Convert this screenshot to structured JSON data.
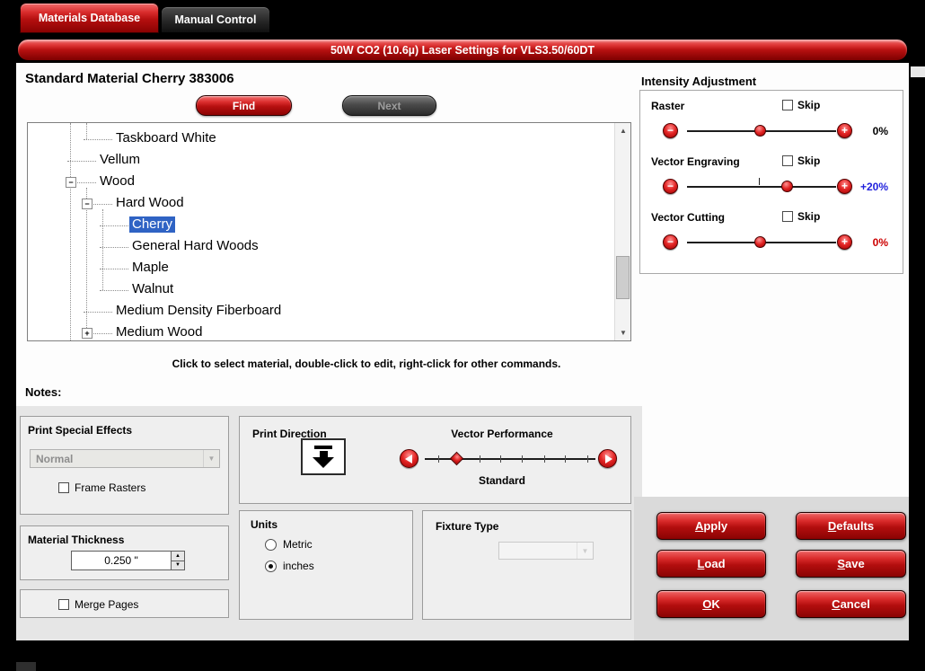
{
  "window": {
    "tabs": [
      {
        "label": "Materials Database",
        "active": true
      },
      {
        "label": "Manual Control",
        "active": false
      }
    ],
    "banner_title": "50W CO2 (10.6µ) Laser Settings for VLS3.50/60DT"
  },
  "material": {
    "title": "Standard Material Cherry 383006",
    "find_label": "Find",
    "next_label": "Next",
    "hint": "Click to select material, double-click to edit, right-click for other commands.",
    "notes_label": "Notes:"
  },
  "tree": {
    "expander_minus": "−",
    "expander_plus": "+",
    "scroll_up_glyph": "▲",
    "scroll_down_glyph": "▼",
    "items": [
      {
        "label": "Taskboard White",
        "level": 2,
        "expander": "none",
        "selected": false
      },
      {
        "label": "Vellum",
        "level": 1,
        "expander": "none",
        "selected": false
      },
      {
        "label": "Wood",
        "level": 1,
        "expander": "minus",
        "selected": false
      },
      {
        "label": "Hard Wood",
        "level": 2,
        "expander": "minus",
        "selected": false
      },
      {
        "label": "Cherry",
        "level": 3,
        "expander": "none",
        "selected": true
      },
      {
        "label": "General Hard Woods",
        "level": 3,
        "expander": "none",
        "selected": false
      },
      {
        "label": "Maple",
        "level": 3,
        "expander": "none",
        "selected": false
      },
      {
        "label": "Walnut",
        "level": 3,
        "expander": "none",
        "selected": false
      },
      {
        "label": "Medium Density Fiberboard",
        "level": 2,
        "expander": "none",
        "selected": false
      },
      {
        "label": "Medium Wood",
        "level": 2,
        "expander": "plus",
        "selected": false
      }
    ]
  },
  "intensity": {
    "title": "Intensity Adjustment",
    "minus_glyph": "−",
    "plus_glyph": "+",
    "rows": [
      {
        "label": "Raster",
        "skip_label": "Skip",
        "skip_checked": false,
        "value": "0%",
        "value_color": "#000000",
        "thumb_percent": 49
      },
      {
        "label": "Vector Engraving",
        "skip_label": "Skip",
        "skip_checked": false,
        "value": "+20%",
        "value_color": "#2222dd",
        "thumb_percent": 67
      },
      {
        "label": "Vector Cutting",
        "skip_label": "Skip",
        "skip_checked": false,
        "value": "0%",
        "value_color": "#cc0000",
        "thumb_percent": 49
      }
    ]
  },
  "print_special_effects": {
    "title": "Print Special Effects",
    "mode": "Normal",
    "frame_rasters_label": "Frame Rasters",
    "frame_rasters_checked": false
  },
  "print_direction": {
    "title": "Print Direction"
  },
  "vector_performance": {
    "title": "Vector Performance",
    "value": "Standard",
    "thumb_percent": 19
  },
  "material_thickness": {
    "title": "Material Thickness",
    "value": "0.250 \""
  },
  "merge_pages": {
    "label": "Merge Pages",
    "checked": false
  },
  "units": {
    "title": "Units",
    "options": [
      {
        "label": "Metric",
        "selected": false
      },
      {
        "label": "inches",
        "selected": true
      }
    ]
  },
  "fixture_type": {
    "title": "Fixture Type",
    "value": ""
  },
  "actions": {
    "apply": "Apply",
    "defaults": "Defaults",
    "load": "Load",
    "save": "Save",
    "ok": "OK",
    "cancel": "Cancel"
  },
  "colors": {
    "accent_red": "#c01212",
    "selection_blue": "#2f63c4",
    "engrave_value_blue": "#2222dd",
    "cut_value_red": "#cc0000"
  }
}
